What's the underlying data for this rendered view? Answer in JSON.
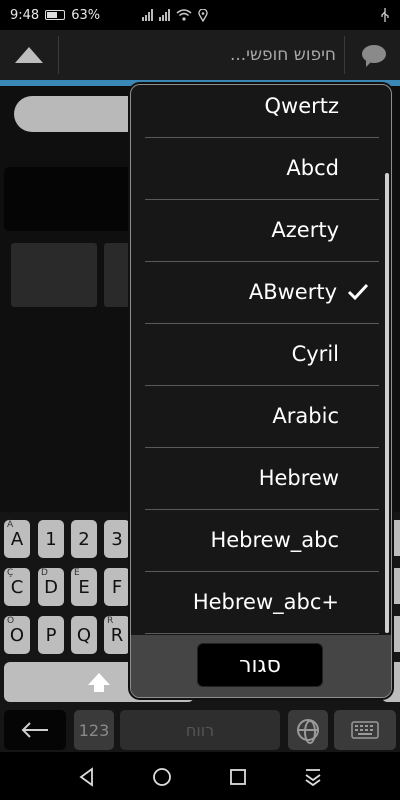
{
  "status_bar": {
    "time": "9:48",
    "battery_percent": "63%",
    "battery_level": 0.63
  },
  "top_bar": {
    "search_placeholder": "חיפוש חופשי..."
  },
  "dropdown": {
    "options": [
      {
        "label": "Qwertz",
        "selected": false
      },
      {
        "label": "Abcd",
        "selected": false
      },
      {
        "label": "Azerty",
        "selected": false
      },
      {
        "label": "ABwerty",
        "selected": true
      },
      {
        "label": "Cyril",
        "selected": false
      },
      {
        "label": "Arabic",
        "selected": false
      },
      {
        "label": "Hebrew",
        "selected": false
      },
      {
        "label": "Hebrew_abc",
        "selected": false
      },
      {
        "label": "Hebrew_abc+",
        "selected": false
      }
    ],
    "close_label": "סגור"
  },
  "keyboard": {
    "row1": [
      {
        "label": "A",
        "sub": "Á"
      },
      {
        "label": "1",
        "sub": ""
      },
      {
        "label": "2",
        "sub": ""
      },
      {
        "label": "3",
        "sub": ""
      }
    ],
    "row2": [
      {
        "label": "C",
        "sub": "Ç"
      },
      {
        "label": "D",
        "sub": "Ď"
      },
      {
        "label": "E",
        "sub": "É"
      },
      {
        "label": "F",
        "sub": ""
      }
    ],
    "row3": [
      {
        "label": "O",
        "sub": "Ö"
      },
      {
        "label": "P",
        "sub": ""
      },
      {
        "label": "Q",
        "sub": ""
      },
      {
        "label": "R",
        "sub": "Ř"
      }
    ],
    "num_key": "123",
    "space_label": "רווח"
  },
  "colors": {
    "accent": "#3a88b6",
    "key": "#bdbdbd",
    "popup_bg": "#171717"
  }
}
